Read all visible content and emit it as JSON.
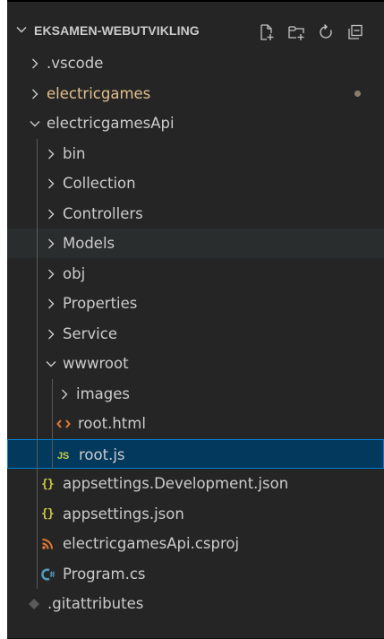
{
  "explorer": {
    "section_title": "EKSAMEN-WEBUTVIKLING",
    "actions": [
      {
        "name": "new-file-icon",
        "title": "New File"
      },
      {
        "name": "new-folder-icon",
        "title": "New Folder"
      },
      {
        "name": "refresh-icon",
        "title": "Refresh Explorer"
      },
      {
        "name": "collapse-all-icon",
        "title": "Collapse Folders in Explorer"
      }
    ]
  },
  "tree": [
    {
      "label": ".vscode",
      "type": "folder",
      "expanded": false,
      "depth": 0
    },
    {
      "label": "electricgames",
      "type": "folder",
      "expanded": false,
      "depth": 0,
      "modified": true
    },
    {
      "label": "electricgamesApi",
      "type": "folder",
      "expanded": true,
      "depth": 0
    },
    {
      "label": "bin",
      "type": "folder",
      "expanded": false,
      "depth": 1
    },
    {
      "label": "Collection",
      "type": "folder",
      "expanded": false,
      "depth": 1
    },
    {
      "label": "Controllers",
      "type": "folder",
      "expanded": false,
      "depth": 1
    },
    {
      "label": "Models",
      "type": "folder",
      "expanded": false,
      "depth": 1,
      "hover": true
    },
    {
      "label": "obj",
      "type": "folder",
      "expanded": false,
      "depth": 1
    },
    {
      "label": "Properties",
      "type": "folder",
      "expanded": false,
      "depth": 1
    },
    {
      "label": "Service",
      "type": "folder",
      "expanded": false,
      "depth": 1
    },
    {
      "label": "wwwroot",
      "type": "folder",
      "expanded": true,
      "depth": 1
    },
    {
      "label": "images",
      "type": "folder",
      "expanded": false,
      "depth": 2
    },
    {
      "label": "root.html",
      "type": "file",
      "icon": "html-icon",
      "depth": 2
    },
    {
      "label": "root.js",
      "type": "file",
      "icon": "js-icon",
      "depth": 2,
      "selected": true
    },
    {
      "label": "appsettings.Development.json",
      "type": "file",
      "icon": "json-icon",
      "depth": 1
    },
    {
      "label": "appsettings.json",
      "type": "file",
      "icon": "json-icon",
      "depth": 1
    },
    {
      "label": "electricgamesApi.csproj",
      "type": "file",
      "icon": "rss-icon",
      "depth": 1
    },
    {
      "label": "Program.cs",
      "type": "file",
      "icon": "csharp-icon",
      "depth": 1
    },
    {
      "label": ".gitattributes",
      "type": "file",
      "icon": "git-icon",
      "depth": 0
    }
  ],
  "colors": {
    "background": "#252526",
    "text": "#cccccc",
    "modified": "#e2c08d",
    "selection_bg": "#04395e",
    "selection_border": "#007fd4",
    "hover_bg": "#2a2d2e",
    "json_icon": "#cbcb41",
    "js_icon": "#cbcb41",
    "html_icon": "#e37933",
    "rss_icon": "#e37933",
    "csharp_icon": "#519aba"
  }
}
